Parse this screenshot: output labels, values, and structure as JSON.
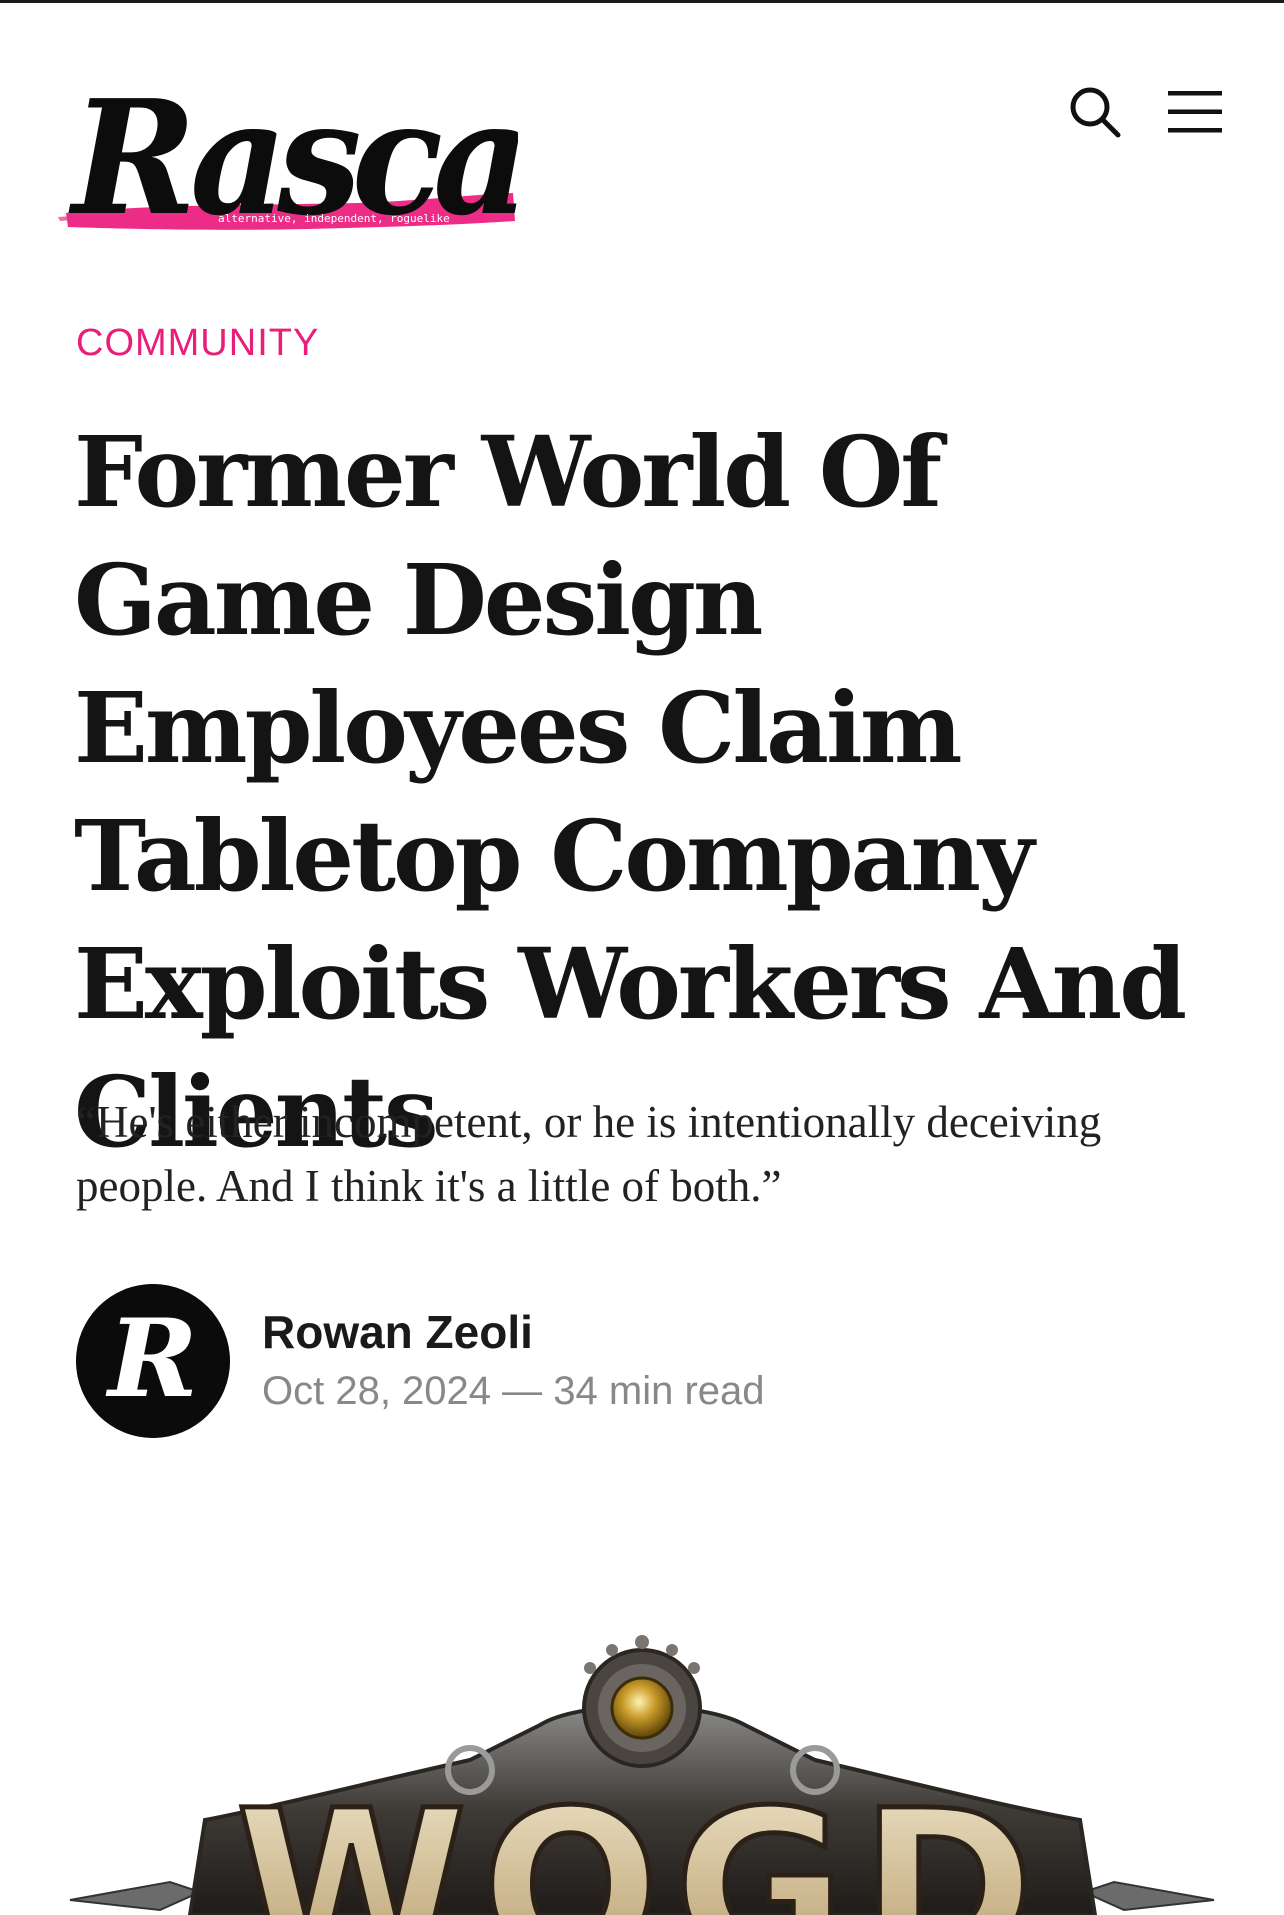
{
  "header": {
    "logo_text": "Rascal",
    "logo_tagline": "alternative, independent, roguelike",
    "search_icon": "search-icon",
    "menu_icon": "hamburger-menu-icon"
  },
  "article": {
    "category": "COMMUNITY",
    "title": "Former World Of Game Design Employees Claim Tabletop Company Exploits Workers And Clients",
    "excerpt": "“He's either incompetent, or he is intentionally deceiving people. And I think it's a little of both.”",
    "author": {
      "name": "Rowan Zeoli",
      "avatar_letter": "R"
    },
    "date": "Oct 28, 2024",
    "separator": "—",
    "read_time": "34 min read",
    "feature_image_text": "WOGD"
  },
  "colors": {
    "accent": "#e91e7a",
    "text": "#141414",
    "muted": "#888888"
  }
}
